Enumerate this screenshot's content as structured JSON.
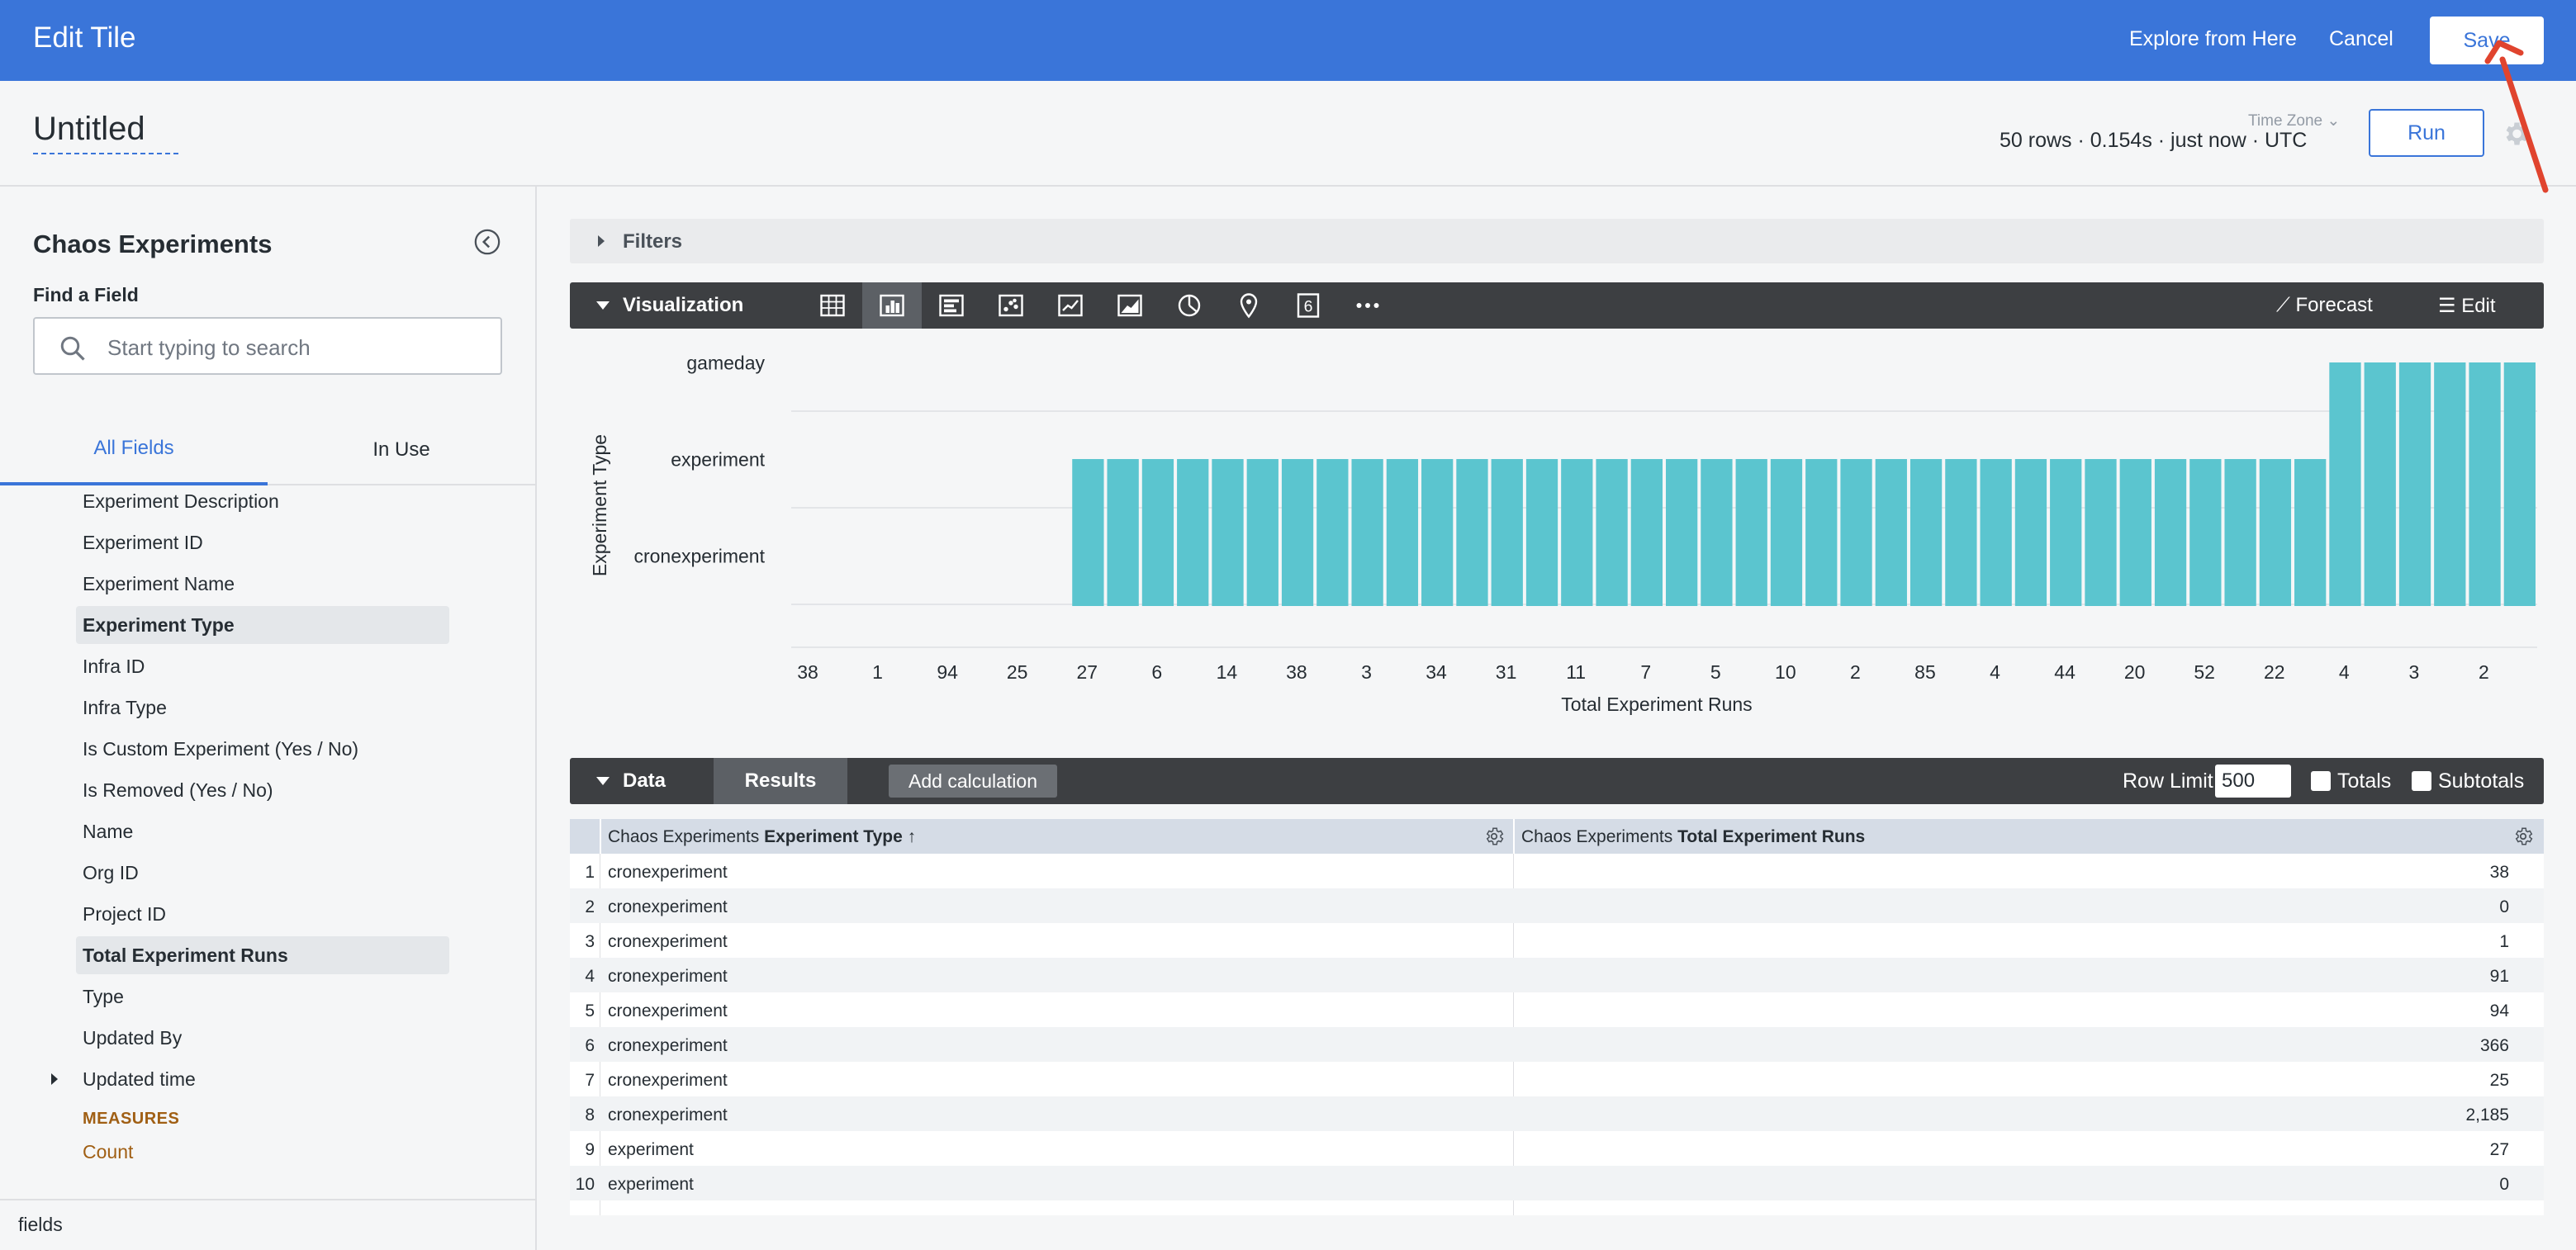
{
  "header": {
    "title": "Edit Tile",
    "explore_label": "Explore from Here",
    "cancel_label": "Cancel",
    "save_label": "Save",
    "accent": "#3a75d9"
  },
  "titlebar": {
    "title": "Untitled",
    "timezone_label": "Time Zone",
    "meta": "50 rows · 0.154s · just now · UTC",
    "run_label": "Run"
  },
  "sidebar": {
    "title": "Chaos Experiments",
    "find_label": "Find a Field",
    "search_placeholder": "Start typing to search",
    "tabs": [
      "All Fields",
      "In Use"
    ],
    "fields": [
      {
        "label": "Experiment Description",
        "selected": false
      },
      {
        "label": "Experiment ID",
        "selected": false
      },
      {
        "label": "Experiment Name",
        "selected": false
      },
      {
        "label": "Experiment Type",
        "selected": true
      },
      {
        "label": "Infra ID",
        "selected": false
      },
      {
        "label": "Infra Type",
        "selected": false
      },
      {
        "label": "Is Custom Experiment (Yes / No)",
        "selected": false
      },
      {
        "label": "Is Removed (Yes / No)",
        "selected": false
      },
      {
        "label": "Name",
        "selected": false
      },
      {
        "label": "Org ID",
        "selected": false
      },
      {
        "label": "Project ID",
        "selected": false
      },
      {
        "label": "Total Experiment Runs",
        "selected": true
      },
      {
        "label": "Type",
        "selected": false
      },
      {
        "label": "Updated By",
        "selected": false
      },
      {
        "label": "Updated time",
        "selected": false
      }
    ],
    "measures_label": "MEASURES",
    "count_label": "Count",
    "footer": "fields"
  },
  "filters": {
    "label": "Filters"
  },
  "visualization": {
    "label": "Visualization",
    "icons": [
      "table-icon",
      "column-chart-icon",
      "bar-chart-icon",
      "scatter-icon",
      "line-chart-icon",
      "area-chart-icon",
      "pie-chart-icon",
      "map-pin-icon",
      "single-value-icon",
      "more-icon"
    ],
    "forecast_label": "Forecast",
    "edit_label": "Edit"
  },
  "chart_data": {
    "type": "bar",
    "xlabel": "Total Experiment Runs",
    "ylabel": "Experiment Type",
    "y_categories": [
      "cronexperiment",
      "experiment",
      "gameday"
    ],
    "x_tick_labels": [
      "38",
      "1",
      "94",
      "25",
      "27",
      "6",
      "14",
      "38",
      "3",
      "34",
      "31",
      "11",
      "7",
      "5",
      "10",
      "2",
      "85",
      "4",
      "44",
      "20",
      "52",
      "22",
      "4",
      "3",
      "2"
    ],
    "bar_levels": [
      0,
      0,
      0,
      0,
      0,
      0,
      0,
      0,
      1,
      1,
      1,
      1,
      1,
      1,
      1,
      1,
      1,
      1,
      1,
      1,
      1,
      1,
      1,
      1,
      1,
      1,
      1,
      1,
      1,
      1,
      1,
      1,
      1,
      1,
      1,
      1,
      1,
      1,
      1,
      1,
      1,
      1,
      1,
      1,
      2,
      2,
      2,
      2,
      2,
      2
    ],
    "bar_color": "#5bc5cf"
  },
  "data": {
    "label": "Data",
    "results_label": "Results",
    "add_calc_label": "Add calculation",
    "row_limit_label": "Row Limit",
    "row_limit_value": "500",
    "totals_label": "Totals",
    "subtotals_label": "Subtotals",
    "columns": [
      {
        "prefix": "Chaos Experiments",
        "name": "Experiment Type",
        "sort": "↑"
      },
      {
        "prefix": "Chaos Experiments",
        "name": "Total Experiment Runs",
        "sort": ""
      }
    ],
    "rows": [
      [
        "1",
        "cronexperiment",
        "38"
      ],
      [
        "2",
        "cronexperiment",
        "0"
      ],
      [
        "3",
        "cronexperiment",
        "1"
      ],
      [
        "4",
        "cronexperiment",
        "91"
      ],
      [
        "5",
        "cronexperiment",
        "94"
      ],
      [
        "6",
        "cronexperiment",
        "366"
      ],
      [
        "7",
        "cronexperiment",
        "25"
      ],
      [
        "8",
        "cronexperiment",
        "2,185"
      ],
      [
        "9",
        "experiment",
        "27"
      ],
      [
        "10",
        "experiment",
        "0"
      ]
    ]
  }
}
